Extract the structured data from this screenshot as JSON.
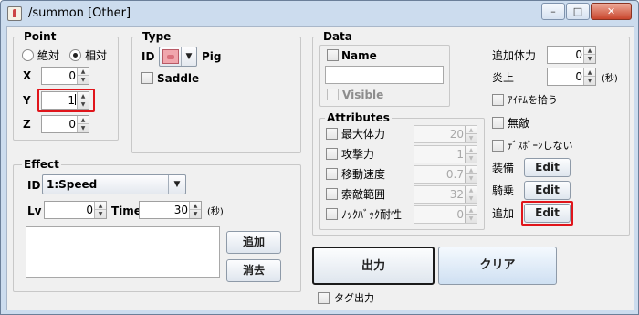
{
  "window": {
    "title": "/summon [Other]",
    "minimize_glyph": "–",
    "maximize_glyph": "□",
    "close_glyph": "✕"
  },
  "point": {
    "legend": "Point",
    "absolute_label": "絶対",
    "relative_label": "相対",
    "selected_mode": "relative",
    "x_label": "X",
    "x_value": "0",
    "y_label": "Y",
    "y_value": "1",
    "z_label": "Z",
    "z_value": "0"
  },
  "type": {
    "legend": "Type",
    "id_label": "ID",
    "mob_name": "Pig",
    "saddle_label": "Saddle"
  },
  "effect": {
    "legend": "Effect",
    "id_label": "ID",
    "id_value": "1:Speed",
    "lv_label": "Lv",
    "lv_value": "0",
    "time_label": "Time",
    "time_value": "30",
    "seconds_label": "(秒)",
    "add_button": "追加",
    "remove_button": "消去"
  },
  "data": {
    "legend": "Data",
    "name_label": "Name",
    "name_value": "",
    "visible_label": "Visible",
    "extra_health_label": "追加体力",
    "extra_health_value": "0",
    "fire_label": "炎上",
    "fire_value": "0",
    "seconds_label": "(秒)",
    "pickup_items_label": "ｱｲﾃﾑを拾う",
    "invulnerable_label": "無敵",
    "no_despawn_label": "ﾃﾞｽﾎﾟｰﾝしない",
    "equipment_label": "装備",
    "riding_label": "騎乗",
    "extra_label": "追加",
    "edit_label": "Edit"
  },
  "attributes": {
    "legend": "Attributes",
    "items": [
      {
        "label": "最大体力",
        "value": "20"
      },
      {
        "label": "攻撃力",
        "value": "1"
      },
      {
        "label": "移動速度",
        "value": "0.7"
      },
      {
        "label": "索敵範囲",
        "value": "32"
      },
      {
        "label": "ﾉｯｸﾊﾞｯｸ耐性",
        "value": "0"
      }
    ]
  },
  "actions": {
    "output_button": "出力",
    "clear_button": "クリア",
    "tag_output_label": "タグ出力"
  },
  "colors": {
    "highlight": "#e0151b",
    "title_bar": "#ccdcee",
    "close_button": "#c8452c"
  }
}
